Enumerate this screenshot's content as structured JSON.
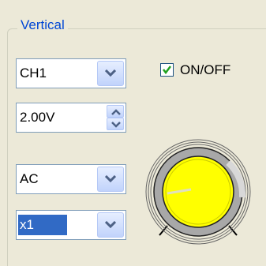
{
  "vertical": {
    "title": "Vertical",
    "channel": {
      "value": "CH1"
    },
    "scale": {
      "value": "2.00V"
    },
    "coupling": {
      "value": "AC"
    },
    "probe": {
      "value": "x1"
    },
    "onoff": {
      "label": "ON/OFF",
      "checked": true
    },
    "knob": {
      "fill_color": "#ffff00",
      "ring_color": "#a8a8a8"
    }
  },
  "colors": {
    "accent": "#316ac5",
    "title": "#0046d5",
    "check": "#21a121"
  }
}
